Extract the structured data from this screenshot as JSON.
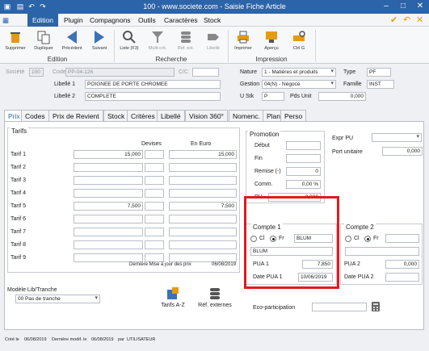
{
  "window": {
    "title": "100 - www.societe.com - Saisie Fiche Article"
  },
  "menu": {
    "items": [
      "Edition",
      "Plugin",
      "Compagnons",
      "Outils",
      "Caractères",
      "Stock"
    ]
  },
  "ribbon": {
    "edition": {
      "label": "Edition",
      "buttons": [
        "Supprimer",
        "Dupliquer",
        "Précédent",
        "Suivant"
      ]
    },
    "recherche": {
      "label": "Recherche",
      "buttons": [
        "Liste (F3)",
        "Multi-crit.",
        "Ref. ext.",
        "Libellé"
      ]
    },
    "impression": {
      "label": "Impression",
      "buttons": [
        "Imprimer",
        "Aperçu",
        "Ctrl G"
      ]
    }
  },
  "header": {
    "societe_label": "Société",
    "societe_value": "100",
    "code_label": "Code",
    "code_value": "PP-04-126",
    "cic_label": "C/C",
    "libelle1_label": "Libellé 1",
    "libelle1_value": "POIGNEE DE PORTE CHROMEE",
    "libelle2_label": "Libellé 2",
    "libelle2_value": "COMPLETE",
    "nature_label": "Nature",
    "nature_value": "1 - Matières et produits",
    "gestion_label": "Gestion",
    "gestion_value": "04(N) - Négoce",
    "ustk_label": "U Stk",
    "ustk_value": "P",
    "pdsunit_label": "Pds Unit",
    "pdsunit_value": "0,000",
    "type_label": "Type",
    "type_value": "PF",
    "famille_label": "Famille",
    "famille_value": "INST"
  },
  "tabs": [
    "Prix",
    "Codes",
    "Prix de Revient",
    "Stock",
    "Critères",
    "Libellé",
    "Vision 360°",
    "Nomenc.",
    "Plan",
    "Perso"
  ],
  "tarifs": {
    "title": "Tarifs",
    "col_devises": "Devises",
    "col_euro": "En Euro",
    "rows": [
      {
        "label": "Tarif 1",
        "value": "15,000",
        "euro": "15,000"
      },
      {
        "label": "Tarif 2",
        "value": "",
        "euro": ""
      },
      {
        "label": "Tarif 3",
        "value": "",
        "euro": ""
      },
      {
        "label": "Tarif 4",
        "value": "",
        "euro": ""
      },
      {
        "label": "Tarif 5",
        "value": "7,500",
        "euro": "7,500"
      },
      {
        "label": "Tarif 6",
        "value": "",
        "euro": ""
      },
      {
        "label": "Tarif 7",
        "value": "",
        "euro": ""
      },
      {
        "label": "Tarif 8",
        "value": "",
        "euro": ""
      },
      {
        "label": "Tarif 9",
        "value": "",
        "euro": ""
      }
    ],
    "last_update_label": "Dernière Mise à jour des prix",
    "last_update_value": "06/08/2019"
  },
  "promotion": {
    "title": "Promotion",
    "debut_label": "Début",
    "fin_label": "Fin",
    "remise_label": "Remise (-)",
    "remise_value": "0",
    "comm_label": "Comm.",
    "comm_value": "0,00 %",
    "pu_label": "PU",
    "pu_value": "0,000"
  },
  "expr": {
    "expr_label": "Expr PU",
    "pu_label": "Port unitaire",
    "pu_value": "0,000"
  },
  "compte1": {
    "title": "Compte 1",
    "cl": "Cl",
    "fr": "Fr",
    "code": "BLUM",
    "name": "BLUM",
    "pua1_label": "PUA 1",
    "pua1_value": "7,850",
    "date_label": "Date PUA 1",
    "date_value": "10/06/2019"
  },
  "compte2": {
    "title": "Compte 2",
    "cl": "Cl",
    "fr": "Fr",
    "pua2_label": "PUA 2",
    "pua2_value": "0,000",
    "date_label": "Date PUA 2"
  },
  "bottom": {
    "modele_label": "Modèle Lib/Tranche",
    "modele_value": "00 Pas de tranche",
    "tarifs_az": "Tarifs A-Z",
    "ref_ext": "Réf. externes",
    "eco_label": "Eco-participation"
  },
  "status": {
    "cree_label": "Créé le",
    "cree_value": "06/08/2019",
    "modif_label": "Dernière modif. le",
    "modif_value": "06/08/2019",
    "par_label": "par",
    "par_value": "UTILISATEUR"
  },
  "colors": {
    "title_bar": "#2b64a9",
    "highlight": "#e2191f",
    "accent": "#e49b12"
  }
}
